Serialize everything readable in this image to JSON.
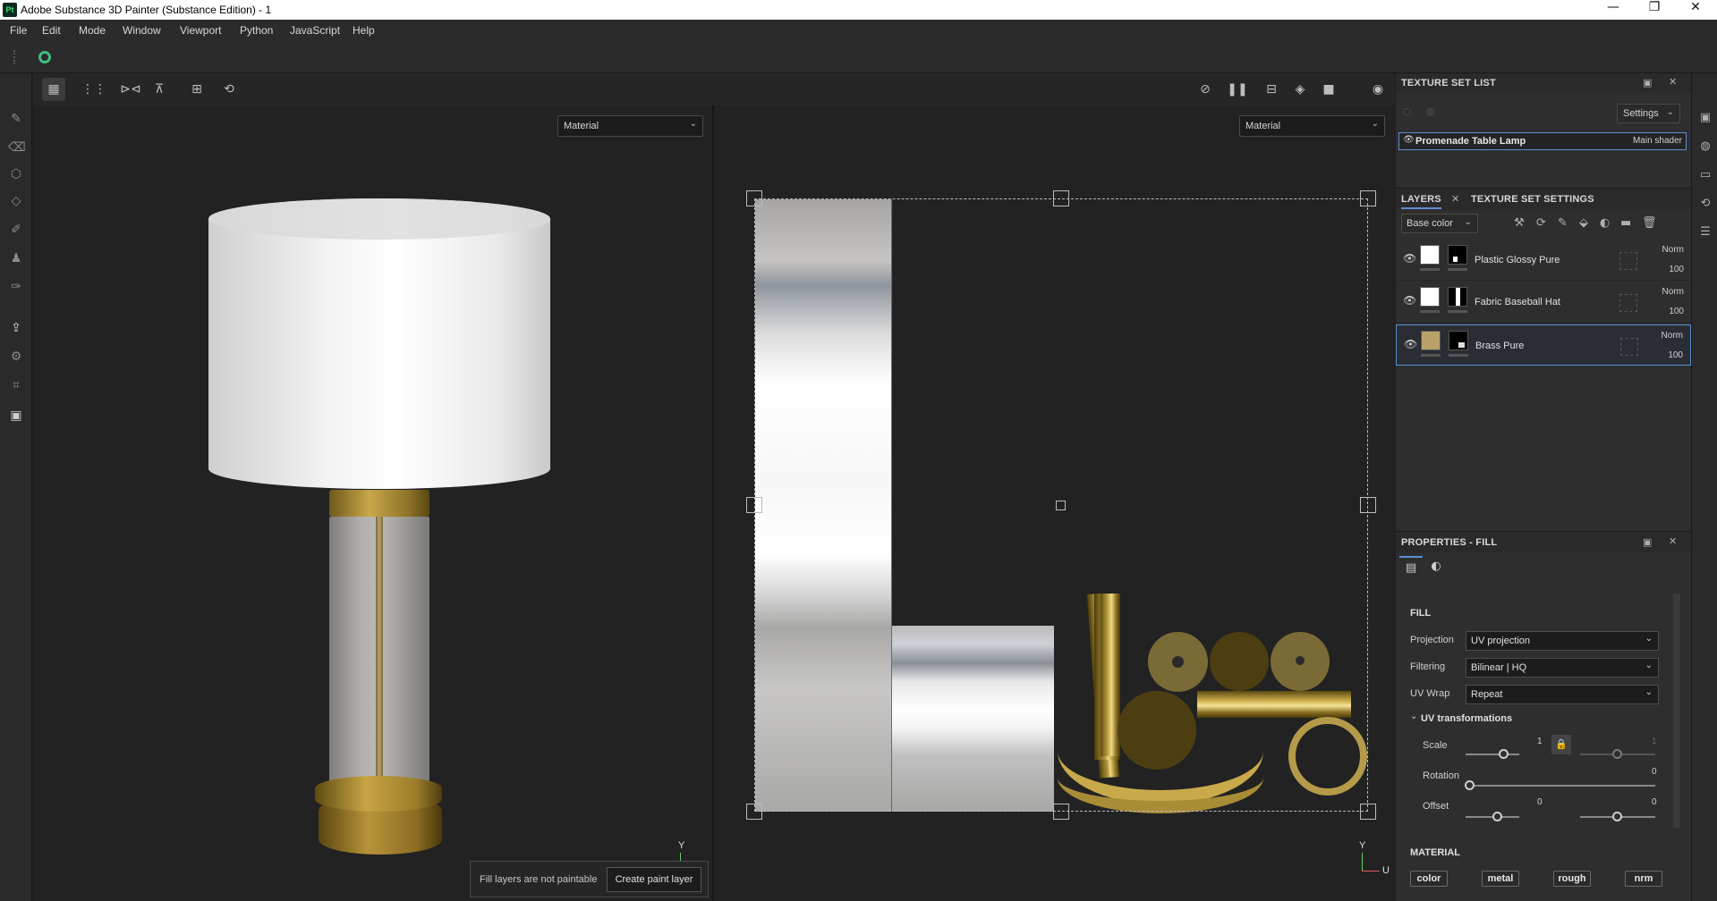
{
  "window": {
    "app_logo": "Pt",
    "title": "Adobe Substance 3D Painter (Substance Edition) - 1",
    "minimize": "—",
    "maximize": "❐",
    "close": "✕"
  },
  "menu": [
    "File",
    "Edit",
    "Mode",
    "Window",
    "Viewport",
    "Python",
    "JavaScript",
    "Help"
  ],
  "viewport": {
    "left_mode": "Material",
    "right_mode": "Material",
    "axis_y": "Y",
    "axis_u": "U"
  },
  "fill_hint": {
    "message": "Fill layers are not paintable",
    "button": "Create paint layer"
  },
  "texture_set_list": {
    "title": "TEXTURE SET LIST",
    "settings": "Settings",
    "item_name": "Promenade Table Lamp",
    "item_shader": "Main shader"
  },
  "layers_panel": {
    "tab_layers": "LAYERS",
    "tab_texture_settings": "TEXTURE SET SETTINGS",
    "channel": "Base color",
    "layers": [
      {
        "name": "Plastic Glossy Pure",
        "blend": "Norm",
        "opacity": "100",
        "color": "#ffffff"
      },
      {
        "name": "Fabric Baseball Hat",
        "blend": "Norm",
        "opacity": "100",
        "color": "#ffffff"
      },
      {
        "name": "Brass Pure",
        "blend": "Norm",
        "opacity": "100",
        "color": "#b9a26a"
      }
    ]
  },
  "properties": {
    "title": "PROPERTIES - FILL",
    "section_fill": "FILL",
    "projection_label": "Projection",
    "projection_value": "UV projection",
    "filtering_label": "Filtering",
    "filtering_value": "Bilinear | HQ",
    "uvwrap_label": "UV Wrap",
    "uvwrap_value": "Repeat",
    "uv_transformations": "UV transformations",
    "scale_label": "Scale",
    "scale_value": "1",
    "scale_value2": "1",
    "rotation_label": "Rotation",
    "rotation_value": "0",
    "offset_label": "Offset",
    "offset_x": "0",
    "offset_y": "0",
    "section_material": "MATERIAL",
    "chips": [
      "color",
      "metal",
      "rough",
      "nrm"
    ]
  }
}
